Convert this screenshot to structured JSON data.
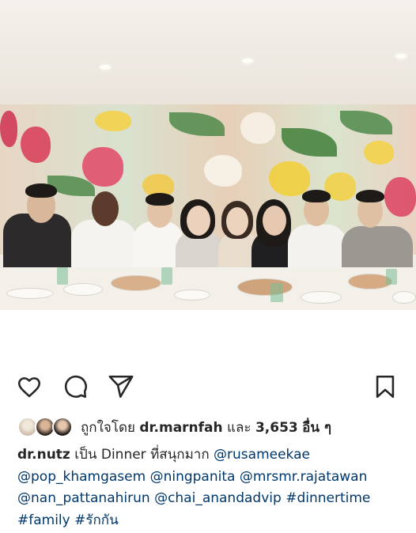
{
  "post": {
    "photo_description_icon": "group-dinner-photo",
    "actions": {
      "like_icon": "heart-icon",
      "comment_icon": "comment-icon",
      "share_icon": "send-icon",
      "save_icon": "bookmark-icon"
    },
    "likes": {
      "liked_by_label": "ถูกใจโดย",
      "liked_by_user": "dr.marnfah",
      "and_label": "และ",
      "count": "3,653",
      "others_label": "อื่น ๆ"
    },
    "caption": {
      "username": "dr.nutz",
      "text": "เป็น Dinner ที่สนุกมาก",
      "mentions": [
        "@rusameekae",
        "@pop_khamgasem",
        "@ningpanita",
        "@mrsmr.rajatawan",
        "@nan_pattanahirun",
        "@chai_anandadvip"
      ],
      "hashtags": [
        "#dinnertime",
        "#family",
        "#รักกัน"
      ]
    }
  },
  "colors": {
    "text": "#262626",
    "link": "#00376b",
    "background": "#ffffff"
  }
}
